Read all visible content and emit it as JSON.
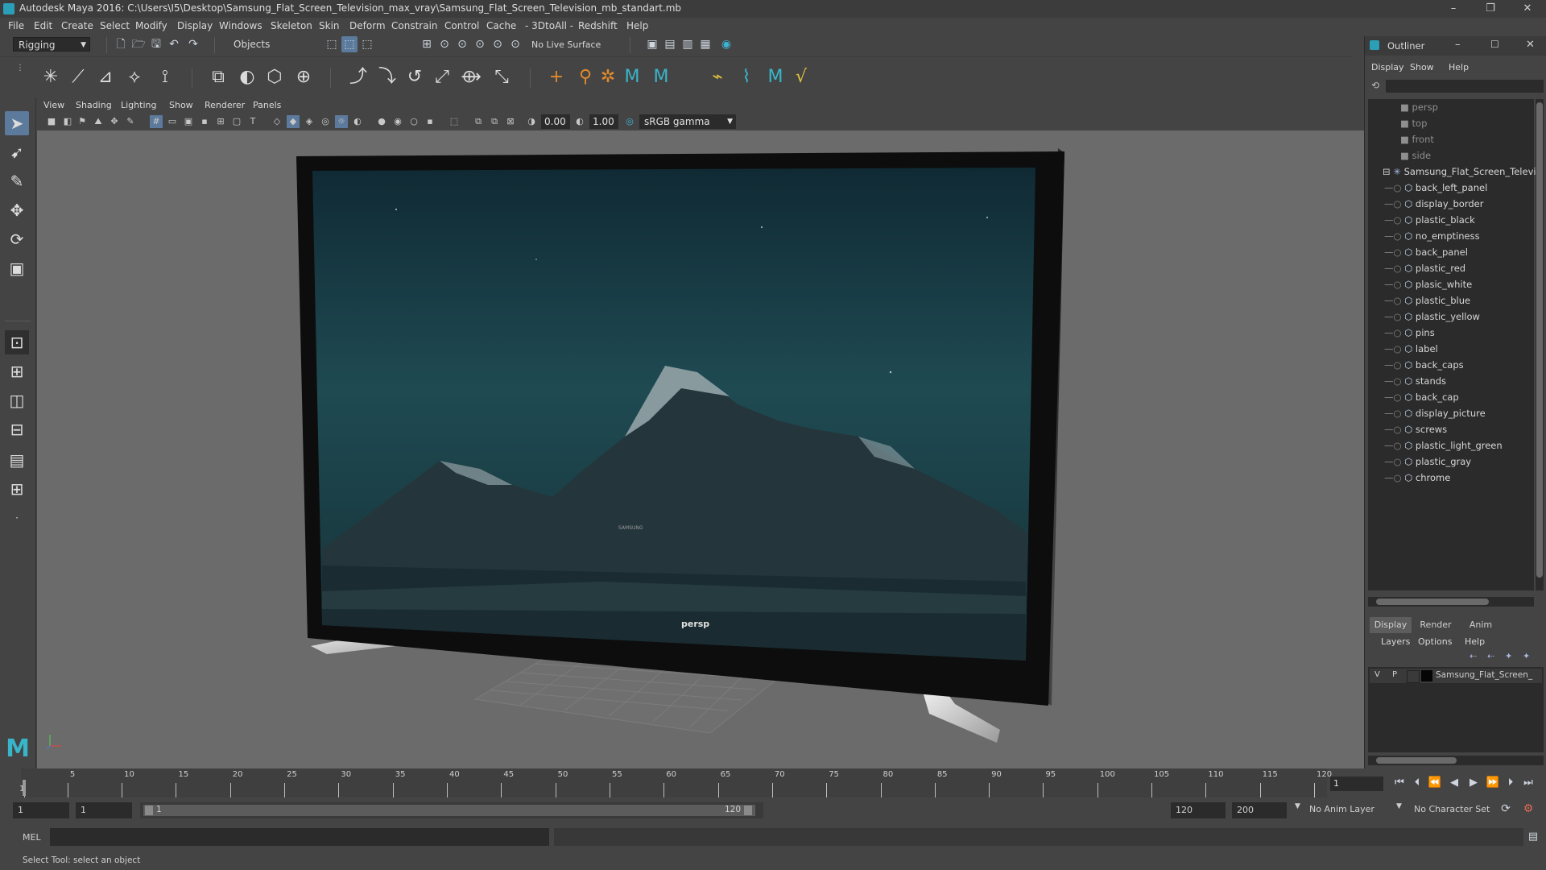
{
  "title_bar": {
    "title": "Autodesk Maya 2016: C:\\Users\\I5\\Desktop\\Samsung_Flat_Screen_Television_max_vray\\Samsung_Flat_Screen_Television_mb_standart.mb",
    "minimize": "–",
    "maximize": "❐",
    "close": "✕"
  },
  "menubar": [
    "File",
    "Edit",
    "Create",
    "Select",
    "Modify",
    "Display",
    "Windows",
    "Skeleton",
    "Skin",
    "Deform",
    "Constrain",
    "Control",
    "Cache",
    "- 3DtoAll -",
    "Redshift",
    "Help"
  ],
  "status_line": {
    "mode": "Rigging",
    "select_mode": "Objects",
    "live_surface": "No Live Surface"
  },
  "viewport": {
    "menu": [
      "View",
      "Shading",
      "Lighting",
      "Show",
      "Renderer",
      "Panels"
    ],
    "exposure": "0.00",
    "gamma": "1.00",
    "color_space": "sRGB gamma",
    "camera_label": "persp",
    "brand_on_tv": "SAMSUNG"
  },
  "outliner": {
    "title": "Outliner",
    "menu": [
      "Display",
      "Show",
      "Help"
    ],
    "cameras": [
      "persp",
      "top",
      "front",
      "side"
    ],
    "group": "Samsung_Flat_Screen_Televis",
    "children": [
      "back_left_panel",
      "display_border",
      "plastic_black",
      "no_emptiness",
      "back_panel",
      "plastic_red",
      "plasic_white",
      "plastic_blue",
      "plastic_yellow",
      "pins",
      "label",
      "back_caps",
      "stands",
      "back_cap",
      "display_picture",
      "screws",
      "plastic_light_green",
      "plastic_gray",
      "chrome"
    ]
  },
  "layer_editor": {
    "tabs": [
      "Display",
      "Render",
      "Anim"
    ],
    "menu": [
      "Layers",
      "Options",
      "Help"
    ],
    "layer": {
      "v": "V",
      "p": "P",
      "name": "Samsung_Flat_Screen_"
    }
  },
  "timeline": {
    "ticks": [
      "1",
      "5",
      "10",
      "15",
      "20",
      "25",
      "30",
      "35",
      "40",
      "45",
      "50",
      "55",
      "60",
      "65",
      "70",
      "75",
      "80",
      "85",
      "90",
      "95",
      "100",
      "105",
      "110",
      "115",
      "120"
    ],
    "current_frame": "1"
  },
  "range": {
    "start": "1",
    "playback_start": "1",
    "slider_start": "1",
    "slider_end": "120",
    "playback_end": "120",
    "end": "200",
    "anim_layer": "No Anim Layer",
    "character_set": "No Character Set"
  },
  "command_line": {
    "label": "MEL"
  },
  "help_line": {
    "text": "Select Tool: select an object"
  }
}
